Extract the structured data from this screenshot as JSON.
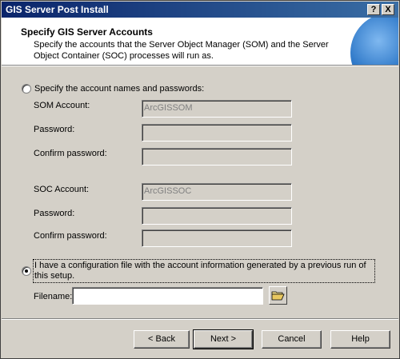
{
  "window": {
    "title": "GIS Server Post Install",
    "help_glyph": "?",
    "close_glyph": "X"
  },
  "header": {
    "title": "Specify GIS Server Accounts",
    "description": "Specify the accounts that the Server Object Manager (SOM) and the Server Object Container (SOC) processes will run as."
  },
  "option_accounts": {
    "label": "Specify the account names and passwords:",
    "checked": false,
    "som_account_label": "SOM Account:",
    "som_account_value": "ArcGISSOM",
    "som_password_label": "Password:",
    "som_confirm_label": "Confirm password:",
    "soc_account_label": "SOC Account:",
    "soc_account_value": "ArcGISSOC",
    "soc_password_label": "Password:",
    "soc_confirm_label": "Confirm password:"
  },
  "option_config": {
    "label": "I have a configuration file with the account information generated by a previous run of this setup.",
    "checked": true,
    "filename_label": "Filename:",
    "filename_value": ""
  },
  "buttons": {
    "back": "< Back",
    "next": "Next >",
    "cancel": "Cancel",
    "help": "Help"
  },
  "icons": {
    "browse": "folder-open-icon",
    "header_graphic": "globe-icon"
  }
}
